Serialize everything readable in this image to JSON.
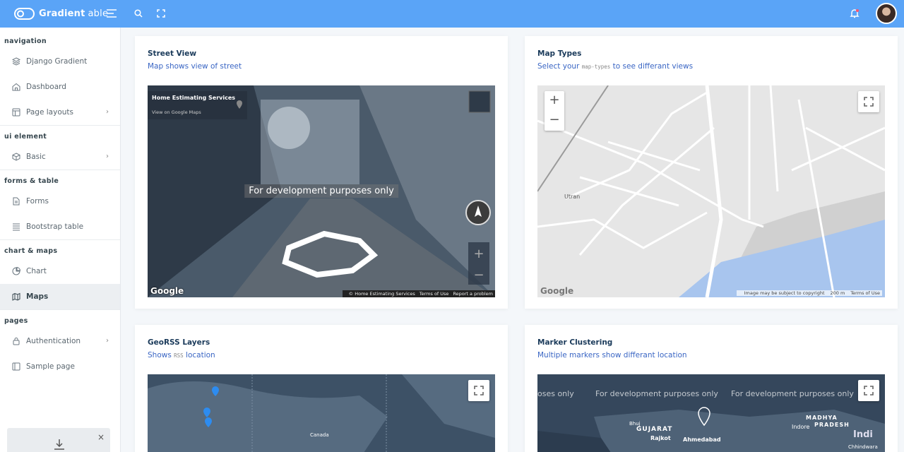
{
  "brand": {
    "name_bold": "Gradient",
    "name_light": "able"
  },
  "topbar": {
    "icons": [
      "menu-icon",
      "search-icon",
      "fullscreen-icon",
      "bell-icon",
      "avatar"
    ]
  },
  "sidebar": {
    "sections": [
      {
        "title": "navigation",
        "items": [
          {
            "label": "Django Gradient",
            "icon": "layers-icon",
            "chevron": false
          },
          {
            "label": "Dashboard",
            "icon": "home-icon",
            "chevron": false
          },
          {
            "label": "Page layouts",
            "icon": "layout-icon",
            "chevron": true
          }
        ]
      },
      {
        "title": "ui element",
        "items": [
          {
            "label": "Basic",
            "icon": "box-icon",
            "chevron": true
          }
        ]
      },
      {
        "title": "forms & table",
        "items": [
          {
            "label": "Forms",
            "icon": "file-text-icon",
            "chevron": false
          },
          {
            "label": "Bootstrap table",
            "icon": "align-justify-icon",
            "chevron": false
          }
        ]
      },
      {
        "title": "chart & maps",
        "items": [
          {
            "label": "Chart",
            "icon": "pie-chart-icon",
            "chevron": false
          },
          {
            "label": "Maps",
            "icon": "map-icon",
            "chevron": false,
            "active": true
          }
        ]
      },
      {
        "title": "pages",
        "items": [
          {
            "label": "Authentication",
            "icon": "lock-icon",
            "chevron": true
          },
          {
            "label": "Sample page",
            "icon": "sidebar-icon",
            "chevron": false
          }
        ]
      }
    ],
    "card_close": "×"
  },
  "cards": {
    "street_view": {
      "title": "Street View",
      "subtitle": "Map shows view of street",
      "info_title": "Home Estimating Services",
      "info_link": "View on Google Maps",
      "dev_message": "For development purposes only",
      "google": "Google",
      "attribution": [
        "© Home Estimating Services",
        "Terms of Use",
        "Report a problem"
      ]
    },
    "map_types": {
      "title": "Map Types",
      "subtitle_pre": "Select your",
      "subtitle_code": "map-types",
      "subtitle_post": "to see differant views",
      "zoom_in": "+",
      "zoom_out": "−",
      "place_label": "Utran",
      "google": "Google",
      "attribution": [
        "Image may be subject to copyright",
        "200 m",
        "Terms of Use"
      ]
    },
    "georss": {
      "title": "GeoRSS Layers",
      "subtitle_pre": "Shows",
      "subtitle_code": "RSS",
      "subtitle_post": "location",
      "place_label": "Canada"
    },
    "clustering": {
      "title": "Marker Clustering",
      "subtitle": "Multiple markers show differant location",
      "dev_messages": [
        "oses only",
        "For development purposes only",
        "For development purposes only"
      ],
      "labels": [
        "GUJARAT",
        "Rajkot",
        "Ahmedabad",
        "Indore",
        "MADHYA",
        "PRADESH",
        "Bhuj",
        "Indi",
        "Chhindwara"
      ]
    }
  },
  "colors": {
    "topbar": "#5aa4f7",
    "link": "#3a66c4",
    "title": "#1a3a5a"
  }
}
